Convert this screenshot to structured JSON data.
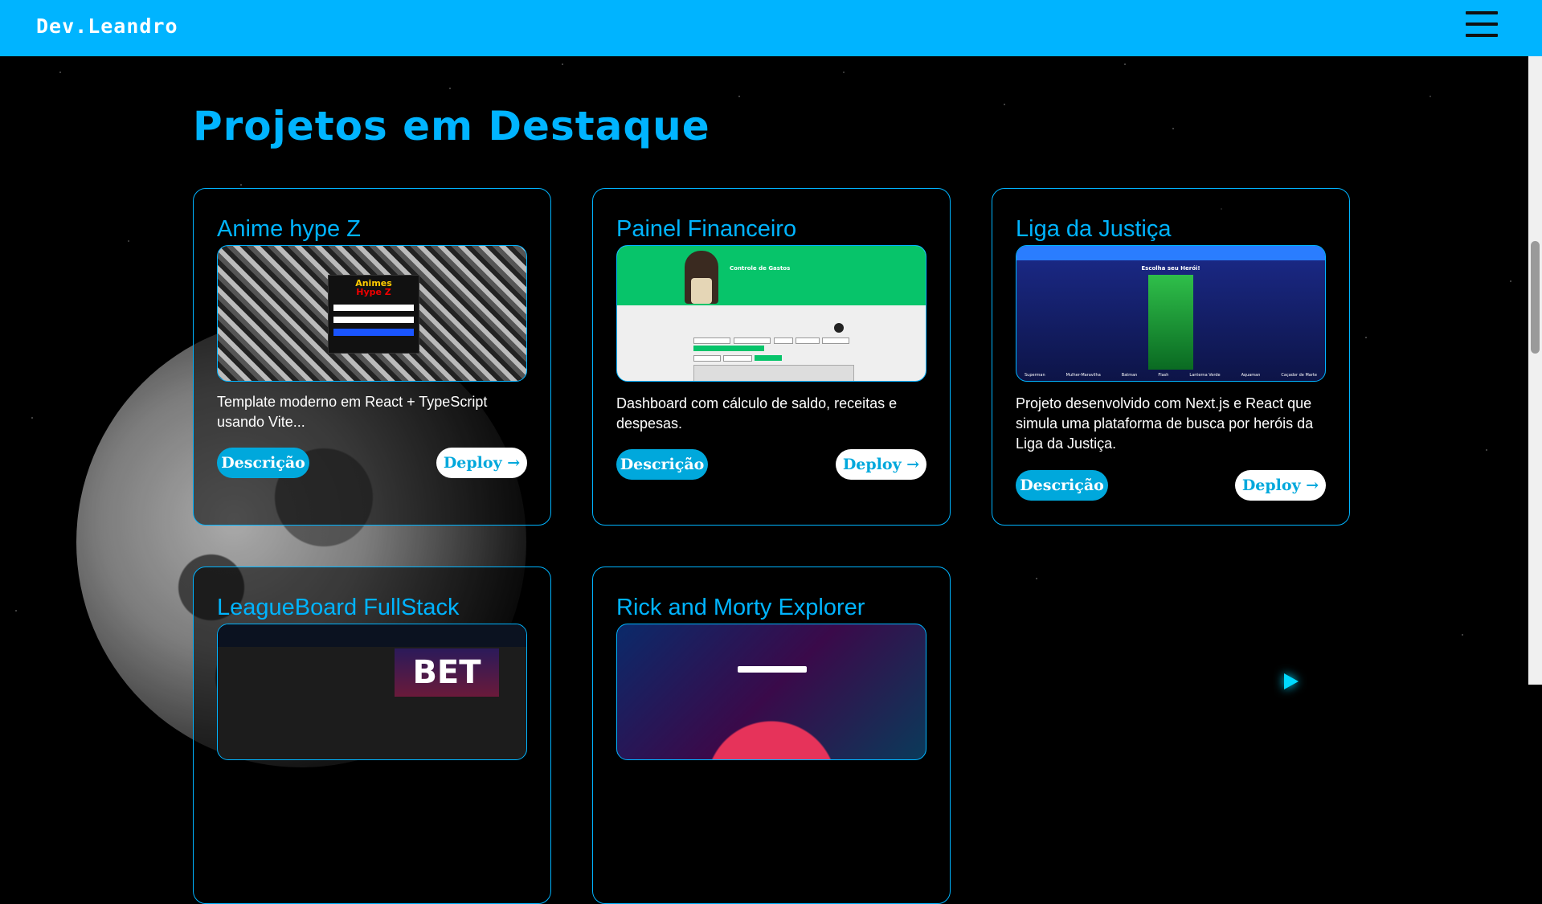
{
  "header": {
    "brand": "Dev.Leandro"
  },
  "section": {
    "title": "Projetos em Destaque"
  },
  "projects": [
    {
      "title": "Anime hype Z",
      "description": "Template moderno em React + TypeScript usando Vite...",
      "description_button": "Descrição",
      "deploy_button": "Deploy →",
      "thumb": {
        "logo_top": "Animes",
        "logo_bottom": "Hype Z"
      }
    },
    {
      "title": "Painel Financeiro",
      "description": "Dashboard com cálculo de saldo, receitas e despesas.",
      "description_button": "Descrição",
      "deploy_button": "Deploy →",
      "thumb": {
        "heading": "Controle de Gastos"
      }
    },
    {
      "title": "Liga da Justiça",
      "description": "Projeto desenvolvido com Next.js e React que simula uma plataforma de busca por heróis da Liga da Justiça.",
      "description_button": "Descrição",
      "deploy_button": "Deploy →",
      "thumb": {
        "heading": "Escolha seu Herói!",
        "heroes": [
          "Superman",
          "Mulher-Maravilha",
          "Batman",
          "Flash",
          "Lanterna Verde",
          "Aquaman",
          "Caçador de Marte"
        ]
      }
    },
    {
      "title": "LeagueBoard FullStack",
      "thumb": {
        "banner": "BET"
      }
    },
    {
      "title": "Rick and Morty Explorer"
    }
  ],
  "colors": {
    "accent": "#00b4ff",
    "header_bg": "#00b4ff",
    "button_desc_bg": "#00a8dc",
    "button_deploy_bg": "#ffffff"
  },
  "icons": {
    "menu": "hamburger-menu-icon",
    "deploy_arrow": "arrow-right-icon"
  }
}
